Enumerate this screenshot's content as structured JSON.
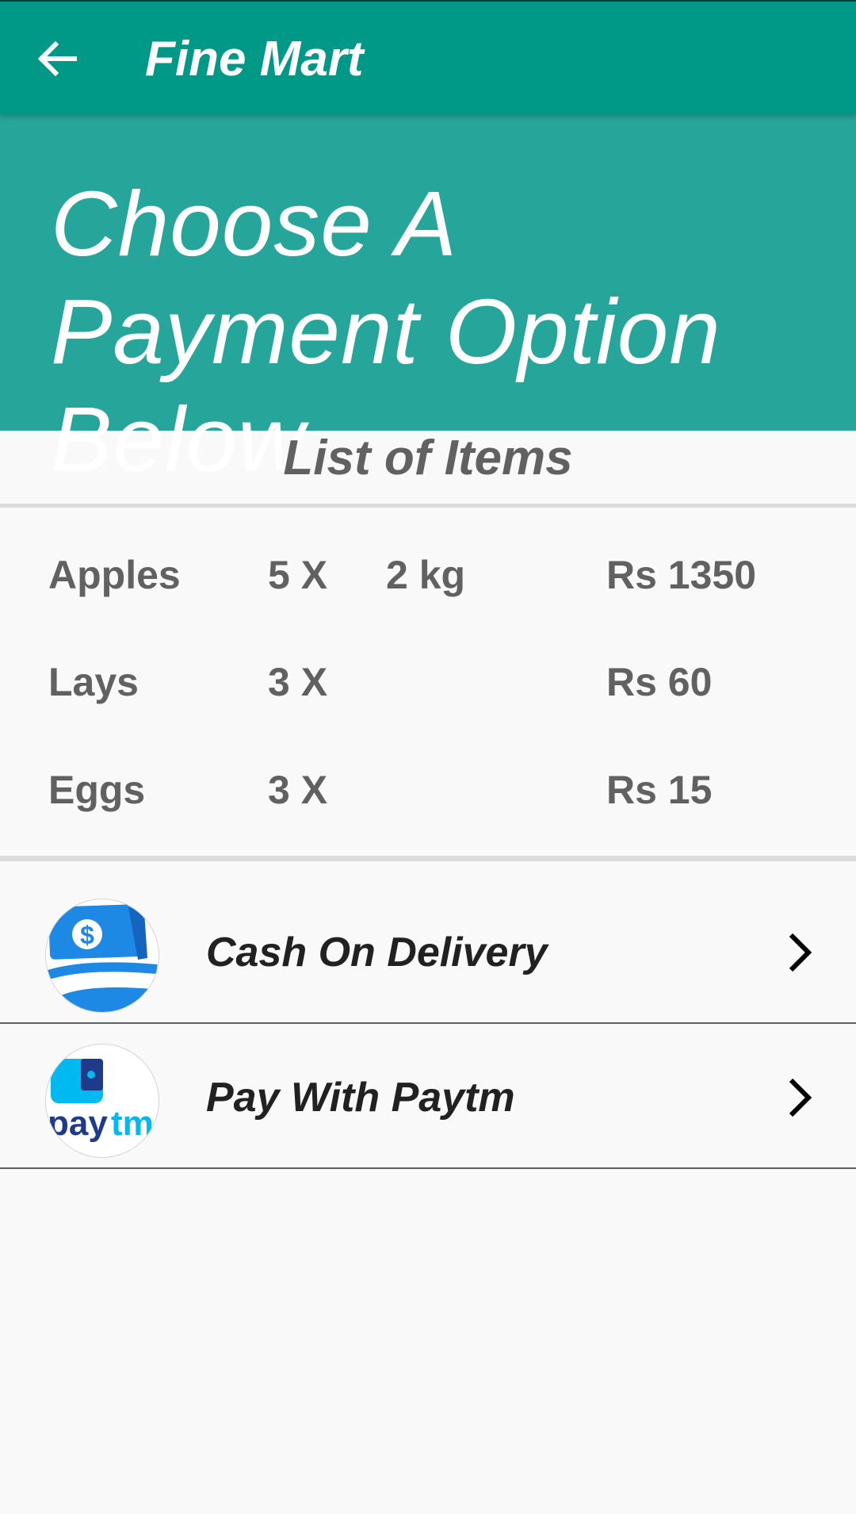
{
  "toolbar": {
    "title": "Fine Mart",
    "back_icon": "arrow-left-icon",
    "background": "#009886"
  },
  "banner": {
    "heading": "Choose A Payment Option Below",
    "background": "#26a69a"
  },
  "items_section": {
    "heading": "List of Items",
    "rows": [
      {
        "name": "Apples",
        "qty": "5 X",
        "weight": "2 kg",
        "price": "Rs 1350"
      },
      {
        "name": "Lays",
        "qty": "3 X",
        "weight": "",
        "price": "Rs 60"
      },
      {
        "name": "Eggs",
        "qty": "3 X",
        "weight": "",
        "price": "Rs 15"
      }
    ]
  },
  "payment_options": [
    {
      "label": "Cash On Delivery",
      "icon": "cash-icon",
      "chevron": "chevron-right-icon"
    },
    {
      "label": "Pay With Paytm",
      "icon": "paytm-logo-icon",
      "chevron": "chevron-right-icon",
      "logo_text": "paytm"
    }
  ]
}
